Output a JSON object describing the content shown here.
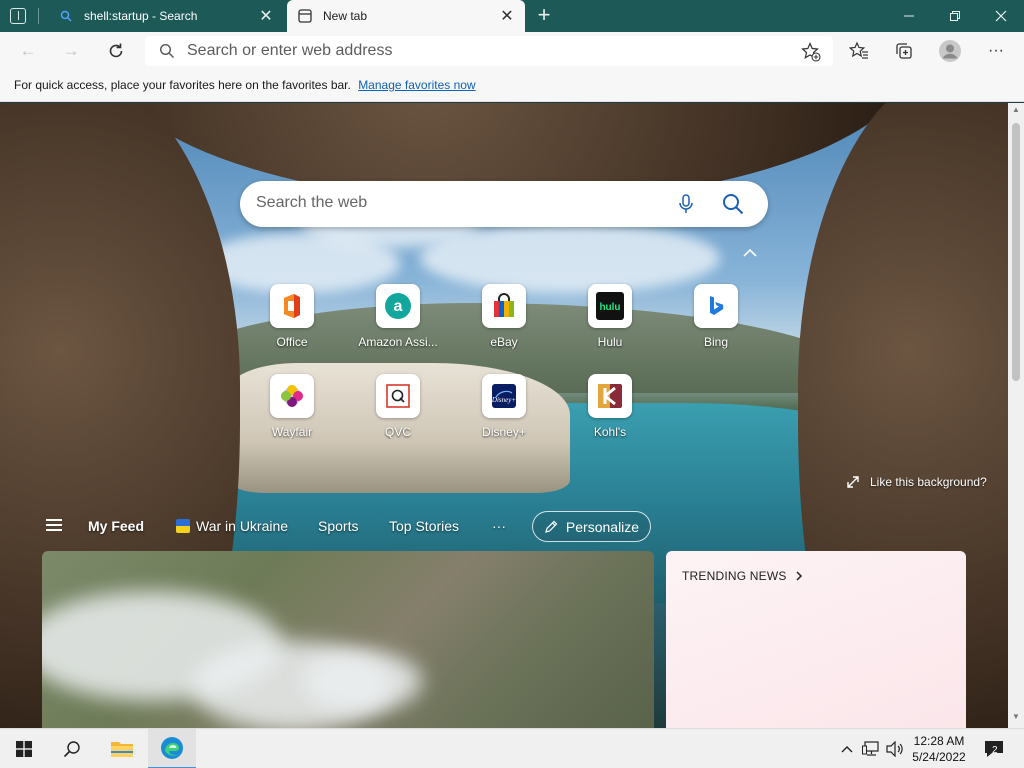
{
  "browser": {
    "tabs": [
      {
        "title": "shell:startup - Search",
        "active": false
      },
      {
        "title": "New tab",
        "active": true
      }
    ],
    "address_bar": {
      "placeholder": "Search or enter web address"
    },
    "favorites_bar": {
      "message": "For quick access, place your favorites here on the favorites bar.",
      "link": "Manage favorites now"
    }
  },
  "newtab": {
    "search": {
      "placeholder": "Search the web"
    },
    "quick_links": [
      {
        "label": "Office",
        "icon": "office-icon"
      },
      {
        "label": "Amazon Assi...",
        "icon": "amazon-assistant-icon"
      },
      {
        "label": "eBay",
        "icon": "ebay-icon"
      },
      {
        "label": "Hulu",
        "icon": "hulu-icon"
      },
      {
        "label": "Bing",
        "icon": "bing-icon"
      },
      {
        "label": "Wayfair",
        "icon": "wayfair-icon"
      },
      {
        "label": "QVC",
        "icon": "qvc-icon"
      },
      {
        "label": "Disney+",
        "icon": "disney-plus-icon"
      },
      {
        "label": "Kohl's",
        "icon": "kohls-icon"
      }
    ],
    "like_background": "Like this background?",
    "feed_nav": {
      "my_feed": "My Feed",
      "war_in_ukraine": "War in Ukraine",
      "sports": "Sports",
      "top_stories": "Top Stories",
      "more": "···",
      "personalize": "Personalize"
    },
    "trending": {
      "title": "TRENDING NEWS"
    }
  },
  "taskbar": {
    "clock": {
      "time": "12:28 AM",
      "date": "5/24/2022"
    },
    "notifications": "2"
  },
  "colors": {
    "titlebar": "#1d5a57",
    "accent": "#0f61b6"
  }
}
